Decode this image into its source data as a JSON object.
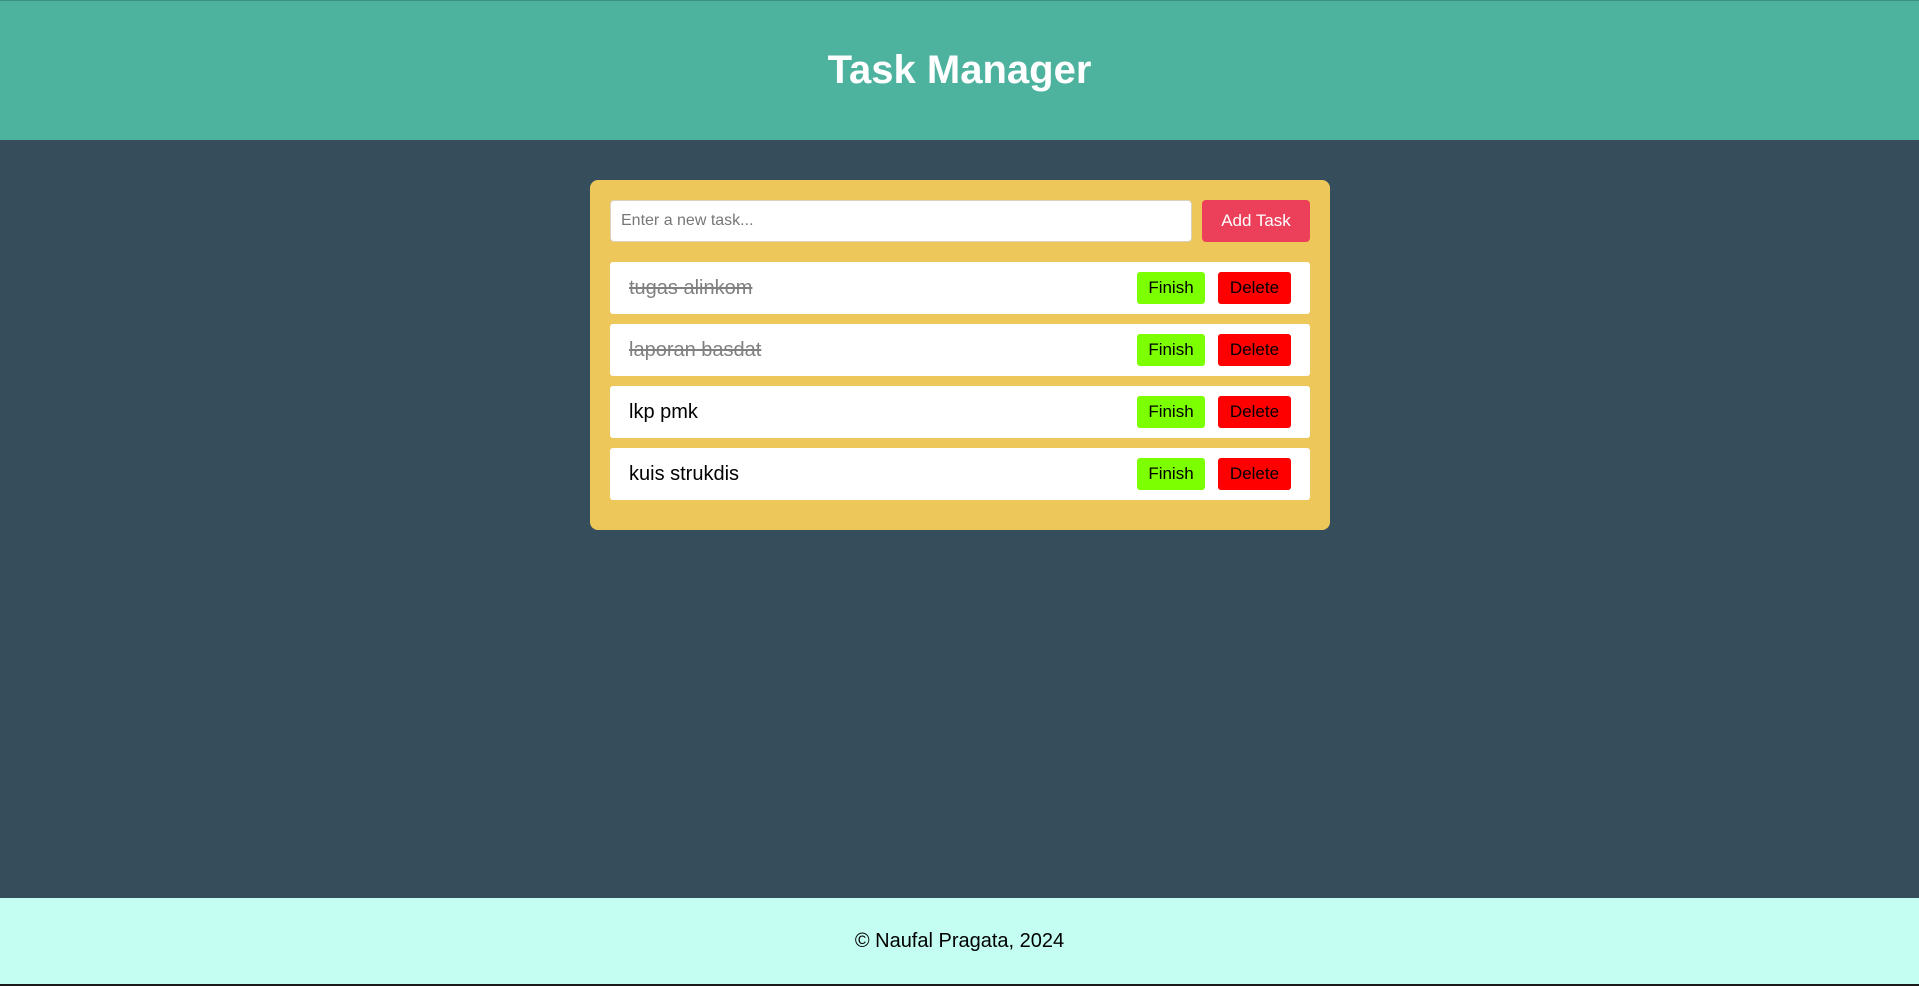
{
  "header": {
    "title": "Task Manager"
  },
  "form": {
    "placeholder": "Enter a new task...",
    "value": "",
    "add_label": "Add Task"
  },
  "tasks": [
    {
      "text": "tugas alinkom",
      "done": true,
      "finish_label": "Finish",
      "delete_label": "Delete"
    },
    {
      "text": "laporan basdat",
      "done": true,
      "finish_label": "Finish",
      "delete_label": "Delete"
    },
    {
      "text": "lkp pmk",
      "done": false,
      "finish_label": "Finish",
      "delete_label": "Delete"
    },
    {
      "text": "kuis strukdis",
      "done": false,
      "finish_label": "Finish",
      "delete_label": "Delete"
    }
  ],
  "footer": {
    "text": "© Naufal Pragata, 2024"
  },
  "colors": {
    "header_bg": "#4db29e",
    "body_bg": "#364e5c",
    "panel_bg": "#eec75b",
    "add_button": "#ec3f59",
    "finish_button": "#7cff00",
    "delete_button": "#ff0000",
    "footer_bg": "#c4fdf1"
  }
}
